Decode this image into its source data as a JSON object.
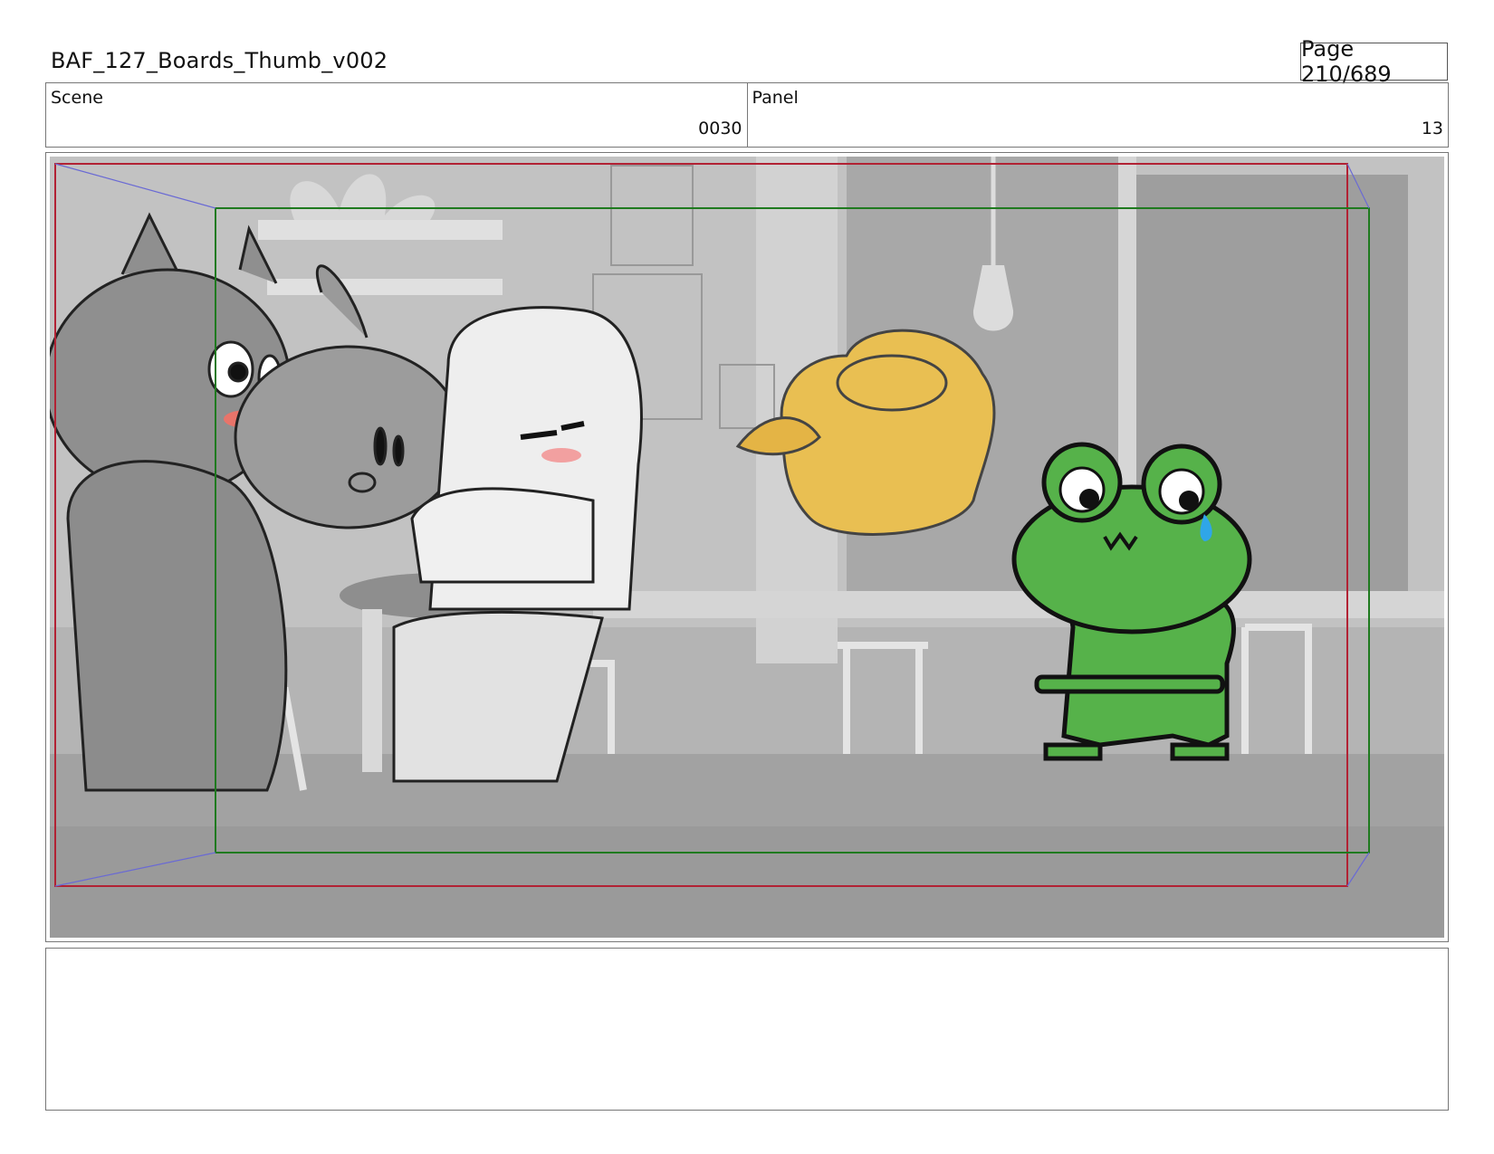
{
  "header": {
    "title": "BAF_127_Boards_Thumb_v002",
    "page": "Page 210/689"
  },
  "info": {
    "scene_label": "Scene",
    "scene_value": "0030",
    "panel_label": "Panel",
    "panel_value": "13"
  },
  "panel": {
    "safe_frame_color": "#b22234",
    "action_frame_color": "#1f7a1f",
    "frog_color": "#56b24a",
    "blob_color": "#e9bf52",
    "background_gray": "#b4b4b4"
  },
  "notes": {
    "text": ""
  }
}
